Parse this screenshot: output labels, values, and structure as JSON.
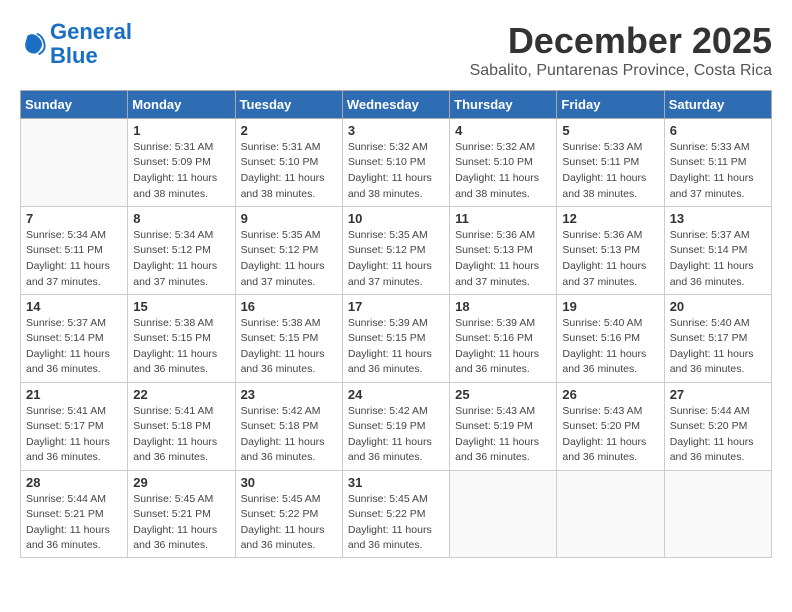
{
  "header": {
    "logo_line1": "General",
    "logo_line2": "Blue",
    "month": "December 2025",
    "location": "Sabalito, Puntarenas Province, Costa Rica"
  },
  "weekdays": [
    "Sunday",
    "Monday",
    "Tuesday",
    "Wednesday",
    "Thursday",
    "Friday",
    "Saturday"
  ],
  "weeks": [
    [
      {
        "day": "",
        "info": ""
      },
      {
        "day": "1",
        "info": "Sunrise: 5:31 AM\nSunset: 5:09 PM\nDaylight: 11 hours and 38 minutes."
      },
      {
        "day": "2",
        "info": "Sunrise: 5:31 AM\nSunset: 5:10 PM\nDaylight: 11 hours and 38 minutes."
      },
      {
        "day": "3",
        "info": "Sunrise: 5:32 AM\nSunset: 5:10 PM\nDaylight: 11 hours and 38 minutes."
      },
      {
        "day": "4",
        "info": "Sunrise: 5:32 AM\nSunset: 5:10 PM\nDaylight: 11 hours and 38 minutes."
      },
      {
        "day": "5",
        "info": "Sunrise: 5:33 AM\nSunset: 5:11 PM\nDaylight: 11 hours and 38 minutes."
      },
      {
        "day": "6",
        "info": "Sunrise: 5:33 AM\nSunset: 5:11 PM\nDaylight: 11 hours and 37 minutes."
      }
    ],
    [
      {
        "day": "7",
        "info": "Sunrise: 5:34 AM\nSunset: 5:11 PM\nDaylight: 11 hours and 37 minutes."
      },
      {
        "day": "8",
        "info": "Sunrise: 5:34 AM\nSunset: 5:12 PM\nDaylight: 11 hours and 37 minutes."
      },
      {
        "day": "9",
        "info": "Sunrise: 5:35 AM\nSunset: 5:12 PM\nDaylight: 11 hours and 37 minutes."
      },
      {
        "day": "10",
        "info": "Sunrise: 5:35 AM\nSunset: 5:12 PM\nDaylight: 11 hours and 37 minutes."
      },
      {
        "day": "11",
        "info": "Sunrise: 5:36 AM\nSunset: 5:13 PM\nDaylight: 11 hours and 37 minutes."
      },
      {
        "day": "12",
        "info": "Sunrise: 5:36 AM\nSunset: 5:13 PM\nDaylight: 11 hours and 37 minutes."
      },
      {
        "day": "13",
        "info": "Sunrise: 5:37 AM\nSunset: 5:14 PM\nDaylight: 11 hours and 36 minutes."
      }
    ],
    [
      {
        "day": "14",
        "info": "Sunrise: 5:37 AM\nSunset: 5:14 PM\nDaylight: 11 hours and 36 minutes."
      },
      {
        "day": "15",
        "info": "Sunrise: 5:38 AM\nSunset: 5:15 PM\nDaylight: 11 hours and 36 minutes."
      },
      {
        "day": "16",
        "info": "Sunrise: 5:38 AM\nSunset: 5:15 PM\nDaylight: 11 hours and 36 minutes."
      },
      {
        "day": "17",
        "info": "Sunrise: 5:39 AM\nSunset: 5:15 PM\nDaylight: 11 hours and 36 minutes."
      },
      {
        "day": "18",
        "info": "Sunrise: 5:39 AM\nSunset: 5:16 PM\nDaylight: 11 hours and 36 minutes."
      },
      {
        "day": "19",
        "info": "Sunrise: 5:40 AM\nSunset: 5:16 PM\nDaylight: 11 hours and 36 minutes."
      },
      {
        "day": "20",
        "info": "Sunrise: 5:40 AM\nSunset: 5:17 PM\nDaylight: 11 hours and 36 minutes."
      }
    ],
    [
      {
        "day": "21",
        "info": "Sunrise: 5:41 AM\nSunset: 5:17 PM\nDaylight: 11 hours and 36 minutes."
      },
      {
        "day": "22",
        "info": "Sunrise: 5:41 AM\nSunset: 5:18 PM\nDaylight: 11 hours and 36 minutes."
      },
      {
        "day": "23",
        "info": "Sunrise: 5:42 AM\nSunset: 5:18 PM\nDaylight: 11 hours and 36 minutes."
      },
      {
        "day": "24",
        "info": "Sunrise: 5:42 AM\nSunset: 5:19 PM\nDaylight: 11 hours and 36 minutes."
      },
      {
        "day": "25",
        "info": "Sunrise: 5:43 AM\nSunset: 5:19 PM\nDaylight: 11 hours and 36 minutes."
      },
      {
        "day": "26",
        "info": "Sunrise: 5:43 AM\nSunset: 5:20 PM\nDaylight: 11 hours and 36 minutes."
      },
      {
        "day": "27",
        "info": "Sunrise: 5:44 AM\nSunset: 5:20 PM\nDaylight: 11 hours and 36 minutes."
      }
    ],
    [
      {
        "day": "28",
        "info": "Sunrise: 5:44 AM\nSunset: 5:21 PM\nDaylight: 11 hours and 36 minutes."
      },
      {
        "day": "29",
        "info": "Sunrise: 5:45 AM\nSunset: 5:21 PM\nDaylight: 11 hours and 36 minutes."
      },
      {
        "day": "30",
        "info": "Sunrise: 5:45 AM\nSunset: 5:22 PM\nDaylight: 11 hours and 36 minutes."
      },
      {
        "day": "31",
        "info": "Sunrise: 5:45 AM\nSunset: 5:22 PM\nDaylight: 11 hours and 36 minutes."
      },
      {
        "day": "",
        "info": ""
      },
      {
        "day": "",
        "info": ""
      },
      {
        "day": "",
        "info": ""
      }
    ]
  ]
}
